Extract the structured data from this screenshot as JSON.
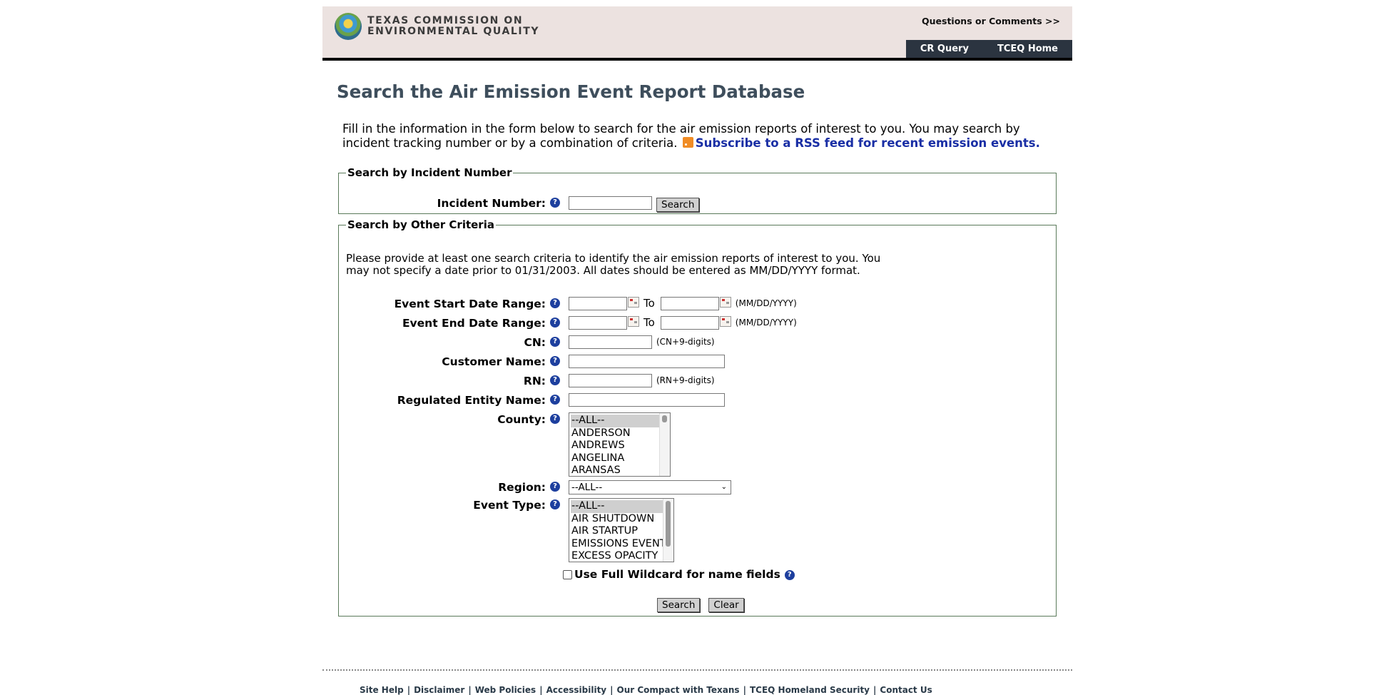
{
  "header": {
    "logo_line1": "TEXAS COMMISSION ON",
    "logo_line2": "ENVIRONMENTAL QUALITY",
    "questions_link": "Questions or Comments >>",
    "nav": [
      "CR Query",
      "TCEQ Home"
    ]
  },
  "page_title": "Search the Air Emission Event Report Database",
  "intro": {
    "text": "Fill in the information in the form below to search for the air emission reports of interest to you. You may search by incident tracking number or by a combination of criteria.",
    "rss_link": "Subscribe to a RSS feed for recent emission events."
  },
  "incident_section": {
    "legend": "Search by Incident Number",
    "label": "Incident Number:",
    "value": "",
    "search_button": "Search"
  },
  "criteria_section": {
    "legend": "Search by Other Criteria",
    "instructions": "Please provide at least one search criteria to identify the air emission reports of interest to you. You may not specify a date prior to 01/31/2003. All dates should be entered as MM/DD/YYYY format.",
    "start_date_label": "Event Start Date Range:",
    "end_date_label": "Event End Date Range:",
    "to_label": "To",
    "date_format_note": "(MM/DD/YYYY)",
    "cn_label": "CN:",
    "cn_note": "(CN+9-digits)",
    "customer_name_label": "Customer Name:",
    "rn_label": "RN:",
    "rn_note": "(RN+9-digits)",
    "regulated_entity_label": "Regulated Entity Name:",
    "county_label": "County:",
    "county_options": [
      "--ALL--",
      "ANDERSON",
      "ANDREWS",
      "ANGELINA",
      "ARANSAS"
    ],
    "region_label": "Region:",
    "region_selected": "--ALL--",
    "event_type_label": "Event Type:",
    "event_type_options": [
      "--ALL--",
      "AIR SHUTDOWN",
      "AIR STARTUP",
      "EMISSIONS EVENT",
      "EXCESS OPACITY"
    ],
    "wildcard_label": "Use Full Wildcard for name fields",
    "search_button": "Search",
    "clear_button": "Clear"
  },
  "help_glyph": "?",
  "footer": {
    "links": [
      "Site Help",
      "Disclaimer",
      "Web Policies",
      "Accessibility",
      "Our Compact with Texans",
      "TCEQ Homeland Security",
      "Contact Us"
    ]
  }
}
